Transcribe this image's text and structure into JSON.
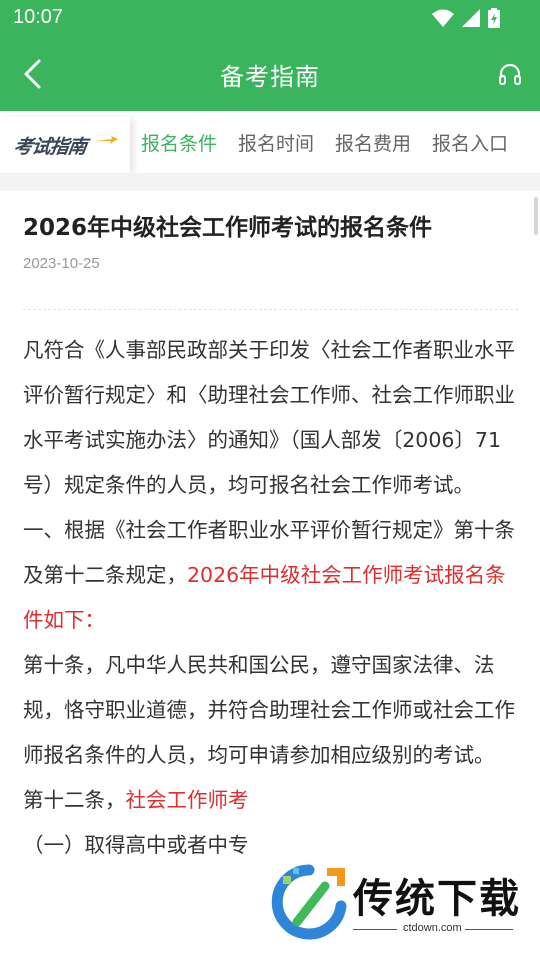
{
  "status_bar": {
    "time": "10:07",
    "icons": [
      "wifi-icon",
      "signal-icon",
      "battery-icon"
    ]
  },
  "app_bar": {
    "title": "备考指南",
    "back_icon": "chevron-left-icon",
    "right_icon": "headset-icon"
  },
  "tab_bar": {
    "logo": "考试指南",
    "tabs": [
      {
        "label": "报名条件",
        "active": true
      },
      {
        "label": "报名时间",
        "active": false
      },
      {
        "label": "报名费用",
        "active": false
      },
      {
        "label": "报名入口",
        "active": false
      }
    ]
  },
  "article": {
    "title": "2026年中级社会工作师考试的报名条件",
    "date": "2023-10-25",
    "p1": "凡符合《人事部民政部关于印发〈社会工作者职业水平评价暂行规定〉和〈助理社会工作师、社会工作师职业水平考试实施办法〉的通知》（国人部发〔2006〕71号）规定条件的人员，均可报名社会工作师考试。",
    "p2_normal": "一、根据《社会工作者职业水平评价暂行规定》第十条及第十二条规定，",
    "p2_red": "2026年中级社会工作师考试报名条件如下：",
    "p3": "第十条，凡中华人民共和国公民，遵守国家法律、法规，恪守职业道德，并符合助理社会工作师或社会工作师报名条件的人员，均可申请参加相应级别的考试。",
    "p4_normal": "第十二条，",
    "p4_red": "社会工作师考",
    "p5": "（一）取得高中或者中专"
  },
  "watermark": {
    "text": "传统下载",
    "url": "ctdown.com"
  },
  "colors": {
    "brand_green": "#3bb55d",
    "accent_red": "#e02d2d"
  }
}
